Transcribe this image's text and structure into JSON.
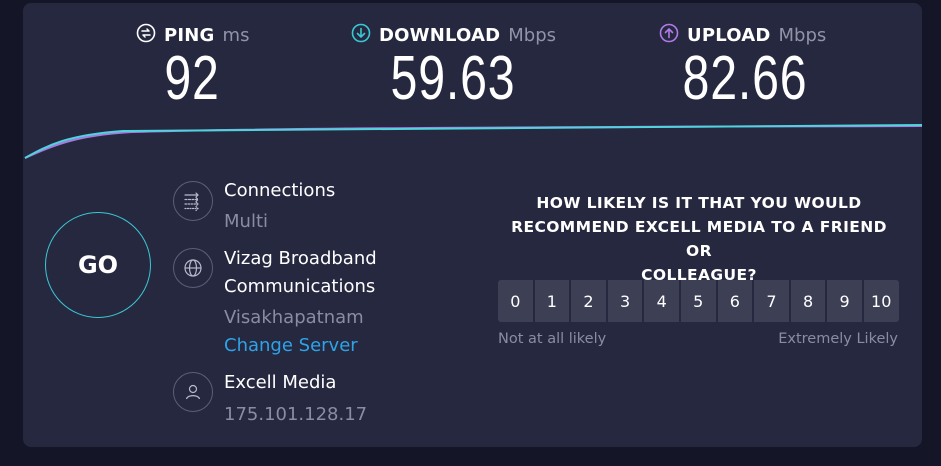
{
  "metrics": {
    "ping": {
      "label": "PING",
      "unit": "ms",
      "value": "92",
      "icon": "ping-icon"
    },
    "download": {
      "label": "DOWNLOAD",
      "unit": "Mbps",
      "value": "59.63",
      "icon": "download-arrow-icon",
      "color": "#3ac8d4"
    },
    "upload": {
      "label": "UPLOAD",
      "unit": "Mbps",
      "value": "82.66",
      "icon": "upload-arrow-icon",
      "color": "#b07be6"
    }
  },
  "go_label": "GO",
  "connections": {
    "title": "Connections",
    "value": "Multi",
    "icon": "connections-icon"
  },
  "server": {
    "name": "Vizag Broadband Communications",
    "name_line1": "Vizag Broadband",
    "name_line2": "Communications",
    "location": "Visakhapatnam",
    "change_label": "Change Server",
    "icon": "globe-icon"
  },
  "provider": {
    "name": "Excell Media",
    "ip": "175.101.128.17",
    "icon": "user-icon"
  },
  "survey": {
    "question": "HOW LIKELY IS IT THAT YOU WOULD RECOMMEND EXCELL MEDIA TO A FRIEND OR COLLEAGUE?",
    "question_line1": "HOW LIKELY IS IT THAT YOU WOULD",
    "question_line2": "RECOMMEND EXCELL MEDIA TO A FRIEND OR",
    "question_line3": "COLLEAGUE?",
    "options": [
      "0",
      "1",
      "2",
      "3",
      "4",
      "5",
      "6",
      "7",
      "8",
      "9",
      "10"
    ],
    "low_label": "Not at all likely",
    "high_label": "Extremely Likely"
  },
  "colors": {
    "background": "#141526",
    "panel": "#262840",
    "accent_download": "#3ac8d4",
    "accent_upload": "#b07be6",
    "link": "#2da4e8"
  }
}
